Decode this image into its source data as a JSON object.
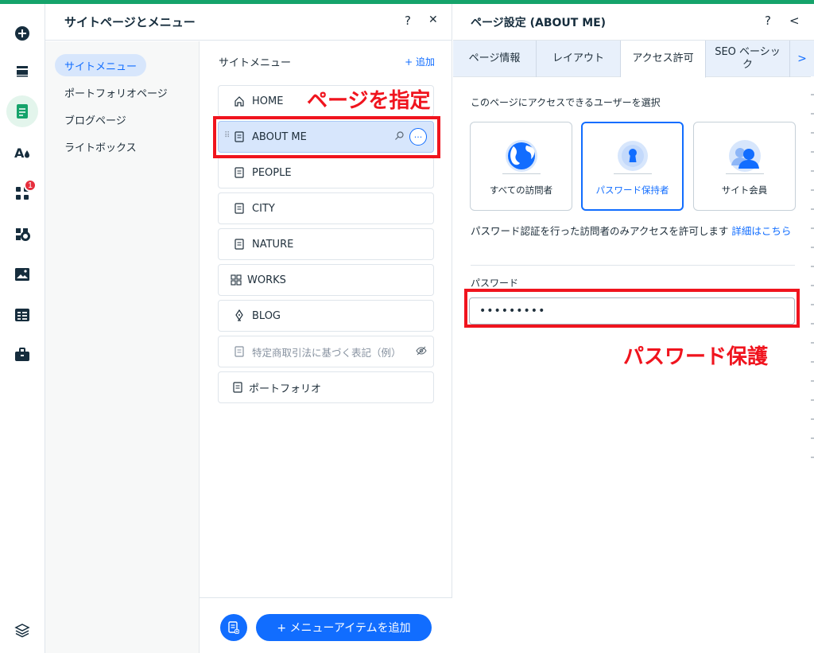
{
  "colors": {
    "accent": "#116dff",
    "brand_green": "#15a36b",
    "annotation_red": "#f0141e",
    "badge_red": "#e62e3d"
  },
  "rail": {
    "items": [
      {
        "name": "add-elements-icon"
      },
      {
        "name": "sections-icon"
      },
      {
        "name": "pages-menus-icon",
        "active": true
      },
      {
        "name": "site-design-icon"
      },
      {
        "name": "apps-icon",
        "badge": "1"
      },
      {
        "name": "business-tools-icon"
      },
      {
        "name": "media-icon"
      },
      {
        "name": "cms-icon"
      },
      {
        "name": "portfolio-icon"
      },
      {
        "name": "layers-icon"
      }
    ]
  },
  "panel1": {
    "title": "サイトページとメニュー",
    "help": "?",
    "close": "✕",
    "nav": [
      "サイトメニュー",
      "ポートフォリオページ",
      "ブログページ",
      "ライトボックス"
    ],
    "menu_label": "サイトメニュー",
    "add_link": "+ 追加",
    "pages": [
      {
        "label": "HOME",
        "icon": "home-icon"
      },
      {
        "label": "ABOUT ME",
        "icon": "page-icon",
        "selected": true
      },
      {
        "label": "PEOPLE",
        "icon": "page-icon"
      },
      {
        "label": "CITY",
        "icon": "page-icon"
      },
      {
        "label": "NATURE",
        "icon": "page-icon"
      },
      {
        "label": "WORKS",
        "icon": "gallery-icon"
      },
      {
        "label": "BLOG",
        "icon": "pen-icon"
      },
      {
        "label": "特定商取引法に基づく表記（例）",
        "icon": "page-icon",
        "hidden": true
      },
      {
        "label": "ポートフォリオ",
        "icon": "page-icon"
      }
    ],
    "more_glyph": "···",
    "add_item_button": "+ メニューアイテムを追加"
  },
  "annotations": {
    "page_select": "ページを指定",
    "password_protect": "パスワード保護"
  },
  "panel2": {
    "title": "ページ設定 (ABOUT ME)",
    "help": "?",
    "back": "<",
    "tabs": [
      "ページ情報",
      "レイアウト",
      "アクセス許可",
      "SEO ベーシック"
    ],
    "active_tab": "アクセス許可",
    "tab_next": ">",
    "access_label": "このページにアクセスできるユーザーを選択",
    "options": [
      "すべての訪問者",
      "パスワード保持者",
      "サイト会員"
    ],
    "selected_option": "パスワード保持者",
    "description": "パスワード認証を行った訪問者のみアクセスを許可します",
    "details_link": "詳細はこちら",
    "password_label": "パスワード",
    "password_value": "•••••••••"
  }
}
